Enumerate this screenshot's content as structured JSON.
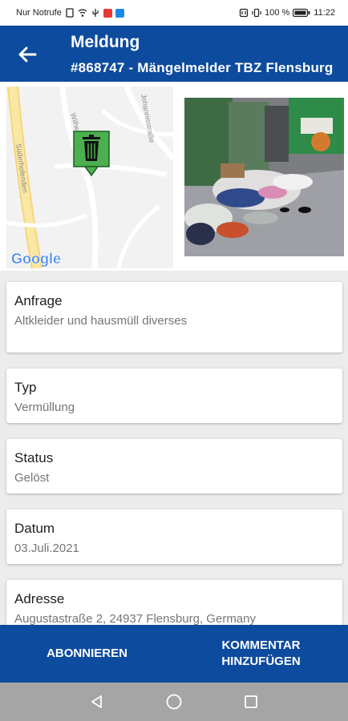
{
  "status_bar": {
    "carrier": "Nur Notrufe",
    "battery": "100 %",
    "time": "11:22"
  },
  "app_bar": {
    "title": "Meldung",
    "subtitle": "#868747 - Mängelmelder TBZ Flensburg"
  },
  "map": {
    "street_1": "Johannisstraße",
    "street_2": "Süderhofenden",
    "street_3": "Wilhe",
    "logo_text": "Google",
    "marker_icon": "trash-can-icon",
    "marker_color": "#4caf50"
  },
  "details": [
    {
      "label": "Anfrage",
      "value": "Altkleider und hausmüll diverses"
    },
    {
      "label": "Typ",
      "value": "Vermüllung"
    },
    {
      "label": "Status",
      "value": "Gelöst"
    },
    {
      "label": "Datum",
      "value": "03.Juli.2021"
    },
    {
      "label": "Adresse",
      "value": "Augustastraße 2, 24937 Flensburg, Germany"
    }
  ],
  "bottom_bar": {
    "subscribe_label": "ABONNIEREN",
    "comment_label_line1": "KOMMENTAR",
    "comment_label_line2": "HINZUFÜGEN"
  },
  "colors": {
    "primary": "#0d4b9e",
    "background": "#ececec",
    "secondary_text": "#757575"
  }
}
